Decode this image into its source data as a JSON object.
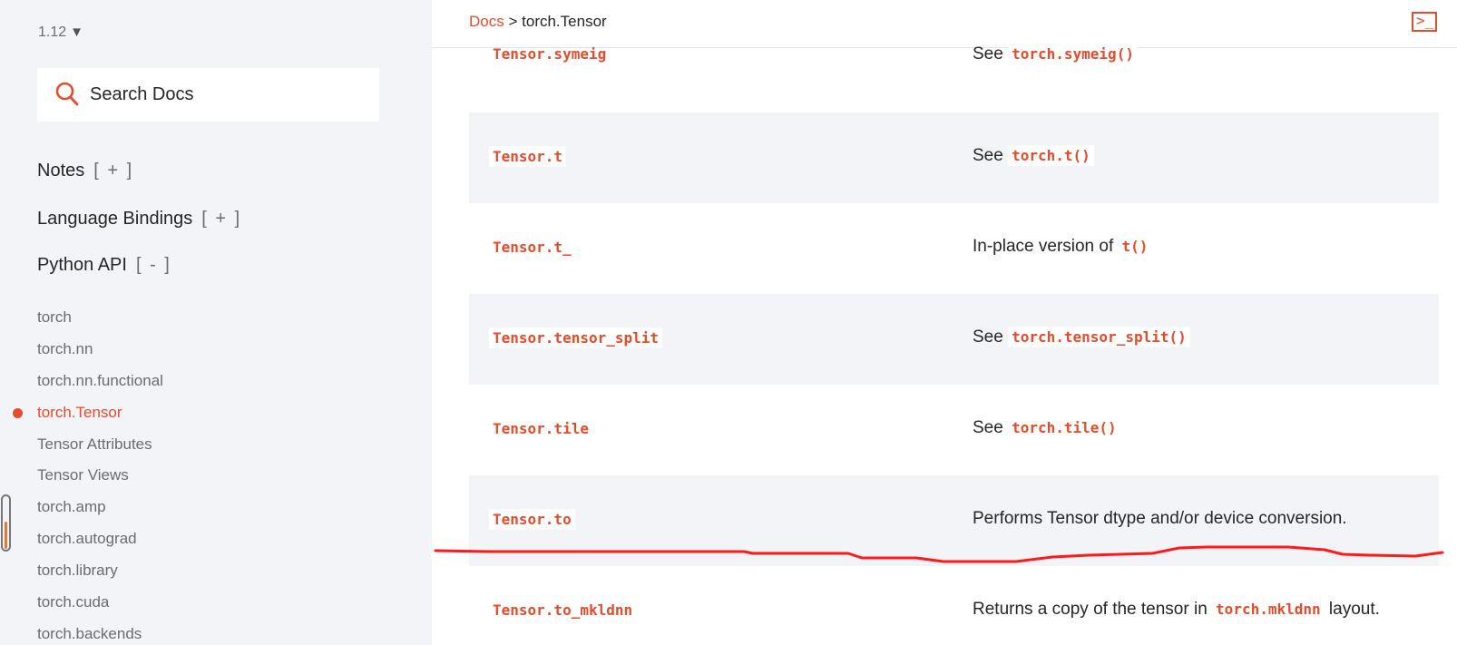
{
  "sidebar": {
    "version": "1.12",
    "version_arrow": "▼",
    "search_placeholder": "Search Docs",
    "sections": [
      {
        "label": "Notes",
        "toggle": "[ + ]"
      },
      {
        "label": "Language Bindings",
        "toggle": "[ + ]"
      },
      {
        "label": "Python API",
        "toggle": "[ - ]"
      }
    ],
    "items": [
      {
        "label": "torch"
      },
      {
        "label": "torch.nn"
      },
      {
        "label": "torch.nn.functional"
      },
      {
        "label": "torch.Tensor",
        "active": true
      },
      {
        "label": "Tensor Attributes"
      },
      {
        "label": "Tensor Views"
      },
      {
        "label": "torch.amp"
      },
      {
        "label": "torch.autograd"
      },
      {
        "label": "torch.library"
      },
      {
        "label": "torch.cuda"
      },
      {
        "label": "torch.backends"
      }
    ]
  },
  "header": {
    "breadcrumb_docs": "Docs",
    "breadcrumb_sep": ">",
    "breadcrumb_current": "torch.Tensor",
    "terminal_icon": ">_"
  },
  "table": {
    "rows": [
      {
        "name": "Tensor.symeig",
        "pre": "See",
        "code": "torch.symeig()",
        "post": ""
      },
      {
        "name": "Tensor.t",
        "pre": "See",
        "code": "torch.t()",
        "post": ""
      },
      {
        "name": "Tensor.t_",
        "pre": "In-place version of",
        "code": "t()",
        "post": ""
      },
      {
        "name": "Tensor.tensor_split",
        "pre": "See",
        "code": "torch.tensor_split()",
        "post": ""
      },
      {
        "name": "Tensor.tile",
        "pre": "See",
        "code": "torch.tile()",
        "post": ""
      },
      {
        "name": "Tensor.to",
        "pre": "Performs Tensor dtype and/or device conversion.",
        "code": "",
        "post": ""
      },
      {
        "name": "Tensor.to_mkldnn",
        "pre": "Returns a copy of the tensor in",
        "code": "torch.mkldnn",
        "post": "layout."
      }
    ]
  },
  "colors": {
    "accent": "#e44c2c",
    "sidebar_bg": "#f3f4f7",
    "annotation": "#ff1a1a"
  }
}
